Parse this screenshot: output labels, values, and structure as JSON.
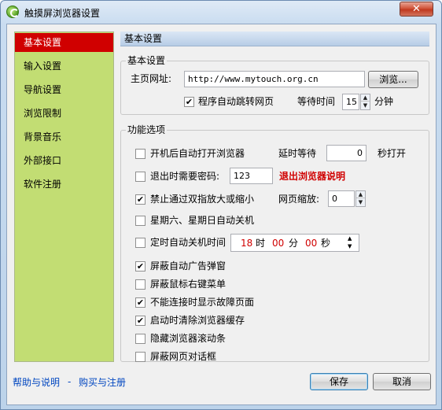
{
  "window": {
    "title": "触摸屏浏览器设置",
    "close_glyph": "✕"
  },
  "sidebar": {
    "items": [
      {
        "label": "基本设置",
        "active": true
      },
      {
        "label": "输入设置"
      },
      {
        "label": "导航设置"
      },
      {
        "label": "浏览限制"
      },
      {
        "label": "背景音乐"
      },
      {
        "label": "外部接口"
      },
      {
        "label": "软件注册"
      }
    ]
  },
  "header": {
    "title": "基本设置"
  },
  "basic": {
    "legend": "基本设置",
    "homepage_label": "主页网址:",
    "homepage_value": "http://www.mytouch.org.cn",
    "browse_label": "浏览...",
    "auto_jump_label": "程序自动跳转网页",
    "auto_jump_checked": true,
    "wait_label": "等待时间",
    "wait_value": "15",
    "wait_unit": "分钟"
  },
  "functions": {
    "legend": "功能选项",
    "autostart": {
      "label": "开机后自动打开浏览器",
      "checked": false,
      "delay_label": "延时等待",
      "delay_value": "0",
      "delay_unit": "秒打开"
    },
    "exit_password": {
      "label": "退出时需要密码:",
      "checked": false,
      "value": "123",
      "help_link": "退出浏览器说明"
    },
    "disable_zoom": {
      "label": "禁止通过双指放大或缩小",
      "checked": true,
      "zoom_label": "网页缩放:",
      "zoom_value": "0"
    },
    "weekend_shutdown": {
      "label": "星期六、星期日自动关机",
      "checked": false
    },
    "timed_shutdown": {
      "label": "定时自动关机时间",
      "checked": false,
      "hour": "18",
      "hour_unit": "时",
      "minute": "00",
      "minute_unit": "分",
      "second": "00",
      "second_unit": "秒"
    },
    "block_popups": {
      "label": "屏蔽自动广告弹窗",
      "checked": true
    },
    "block_context_menu": {
      "label": "屏蔽鼠标右键菜单",
      "checked": false
    },
    "hide_error_page": {
      "label": "不能连接时显示故障页面",
      "checked": true
    },
    "clear_cache": {
      "label": "启动时清除浏览器缓存",
      "checked": true
    },
    "hide_scrollbar": {
      "label": "隐藏浏览器滚动条",
      "checked": false
    },
    "block_dialogs": {
      "label": "屏蔽网页对话框",
      "checked": false
    }
  },
  "footer": {
    "help_link": "帮助与说明",
    "separator": "-",
    "buy_link": "购买与注册",
    "save_label": "保存",
    "cancel_label": "取消"
  },
  "check_glyph": "✔",
  "spin_up_glyph": "▲",
  "spin_down_glyph": "▼",
  "colors": {
    "accent_red": "#d00000",
    "sidebar_green": "#c2dd73",
    "link_blue": "#0046c0"
  }
}
